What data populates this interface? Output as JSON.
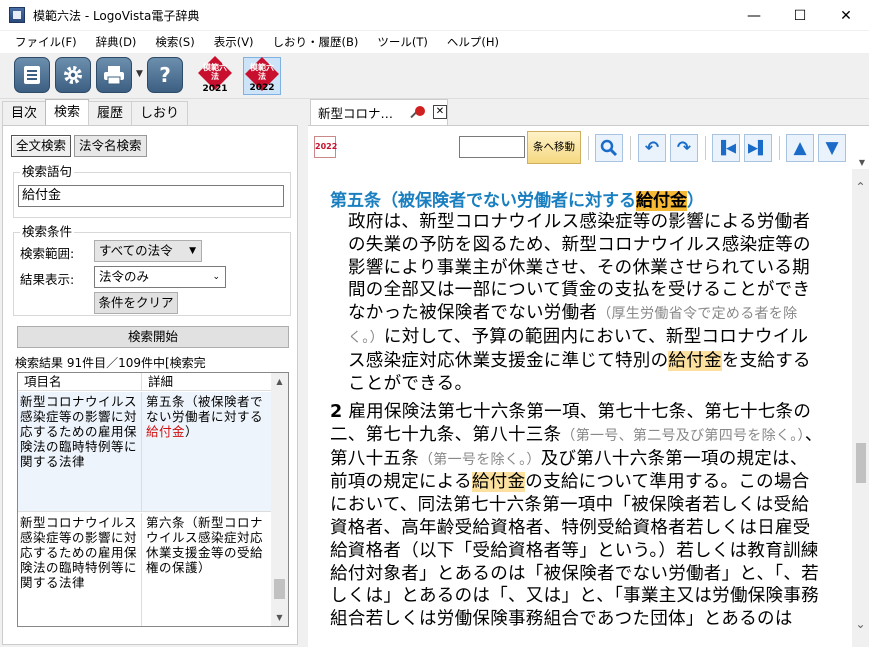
{
  "window": {
    "title": "模範六法 - LogoVista電子辞典",
    "minimize": "—",
    "maximize": "☐",
    "close": "✕"
  },
  "menu": [
    "ファイル(F)",
    "辞典(D)",
    "検索(S)",
    "表示(V)",
    "しおり・履歴(B)",
    "ツール(T)",
    "ヘルプ(H)"
  ],
  "toolbar": {
    "books": [
      {
        "label": "模範六法",
        "year": "2021"
      },
      {
        "label": "模範六法",
        "year": "2022"
      }
    ]
  },
  "left_tabs": [
    "目次",
    "検索",
    "履歴",
    "しおり"
  ],
  "search_modes": [
    "全文検索",
    "法令名検索"
  ],
  "search": {
    "term_label": "検索語句",
    "term_value": "給付金",
    "conditions_label": "検索条件",
    "range_label": "検索範囲:",
    "range_value": "すべての法令",
    "display_label": "結果表示:",
    "display_value": "法令のみ",
    "clear_button": "条件をクリア",
    "start_button": "検索開始"
  },
  "results": {
    "summary": "検索結果 91件目／109件中[検索完",
    "col_item": "項目名",
    "col_detail": "詳細",
    "rows": [
      {
        "item": "新型コロナウイルス感染症等の影響に対応するための雇用保険法の臨時特例等に関する法律",
        "detail_pre": "第五条（被保険者でない労働者に対する",
        "detail_hl": "給付金",
        "detail_post": "）"
      },
      {
        "item": "新型コロナウイルス感染症等の影響に対応するための雇用保険法の臨時特例等に関する法律",
        "detail_pre": "第六条（新型コロナウイルス感染症対応休業支援金等の受給権の保護）",
        "detail_hl": "",
        "detail_post": ""
      }
    ]
  },
  "doc": {
    "tab_title": "新型コロナ…",
    "mini_book": "2022",
    "jump_button": "条へ移動",
    "title_pre": "第五条（被保険者でない労働者に対する",
    "title_hl": "給付金",
    "title_post": "）",
    "p1_a": "政府は、新型コロナウイルス感染症等の影響による労働者の失業の予防を図るため、新型コロナウイルス感染症等の影響により事業主が休業させ、その休業させられている期間の全部又は一部について賃金の支払を受けることができなかった被保険者でない労働者",
    "p1_note": "（厚生労働省令で定める者を除く。）",
    "p1_b": "に対して、予算の範囲内において、新型コロナウイルス感染症対応休業支援金に準じて特別の",
    "p1_hl": "給付金",
    "p1_c": "を支給することができる。",
    "p2_num": "2",
    "p2_a": "雇用保険法第七十六条第一項、第七十七条、第七十七条の二、第七十九条、第八十三条",
    "p2_note1": "（第一号、第二号及び第四号を除く。）",
    "p2_b": "、第八十五条",
    "p2_note2": "（第一号を除く。）",
    "p2_c": "及び第八十六条第一項の規定は、前項の規定による",
    "p2_hl": "給付金",
    "p2_d": "の支給について準用する。この場合において、同法第七十六条第一項中「被保険者若しくは受給資格者、高年齢受給資格者、特例受給資格者若しくは日雇受給資格者（以下「受給資格者等」という。）若しくは教育訓練給付対象者」とあるのは「被保険者でない労働者」と、「、若しくは」とあるのは「、又は」と、「事業主又は労働保険事務組合若しくは労働保険事務組合であつた団体」とあるのは"
  }
}
